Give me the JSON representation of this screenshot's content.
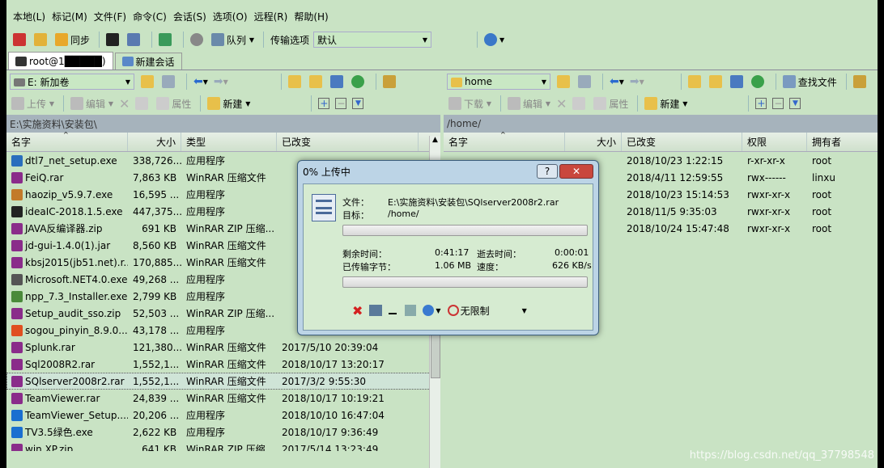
{
  "menu": [
    "本地(L)",
    "标记(M)",
    "文件(F)",
    "命令(C)",
    "会话(S)",
    "选项(O)",
    "远程(R)",
    "帮助(H)"
  ],
  "toolbar": {
    "sync_label": "同步",
    "queue_label": "队列",
    "transfer_options_label": "传输选项",
    "transfer_options_value": "默认"
  },
  "tabs": [
    {
      "label": "root@1█████)"
    },
    {
      "label": "新建会话"
    }
  ],
  "left": {
    "drive": "E: 新加卷",
    "upload": "上传",
    "edit": "编辑",
    "properties": "属性",
    "new": "新建",
    "path": "E:\\实施资料\\安装包\\",
    "columns": [
      "名字",
      "大小",
      "类型",
      "已改变"
    ],
    "rows": [
      {
        "name": "dtl7_net_setup.exe",
        "size": "338,726...",
        "type": "应用程序",
        "date": "",
        "color": "#2a6ebd"
      },
      {
        "name": "FeiQ.rar",
        "size": "7,863 KB",
        "type": "WinRAR 压缩文件",
        "date": "",
        "color": "#8a2c8a"
      },
      {
        "name": "haozip_v5.9.7.exe",
        "size": "16,595 ...",
        "type": "应用程序",
        "date": "",
        "color": "#c27a2a"
      },
      {
        "name": "ideaIC-2018.1.5.exe",
        "size": "447,375...",
        "type": "应用程序",
        "date": "",
        "color": "#222"
      },
      {
        "name": "JAVA反编译器.zip",
        "size": "691 KB",
        "type": "WinRAR ZIP 压缩...",
        "date": "",
        "color": "#8a2c8a"
      },
      {
        "name": "jd-gui-1.4.0(1).jar",
        "size": "8,560 KB",
        "type": "WinRAR 压缩文件",
        "date": "",
        "color": "#8a2c8a"
      },
      {
        "name": "kbsj2015(jb51.net).r...",
        "size": "170,885...",
        "type": "WinRAR 压缩文件",
        "date": "",
        "color": "#8a2c8a"
      },
      {
        "name": "Microsoft.NET4.0.exe",
        "size": "49,268 ...",
        "type": "应用程序",
        "date": "",
        "color": "#555"
      },
      {
        "name": "npp_7.3_Installer.exe",
        "size": "2,799 KB",
        "type": "应用程序",
        "date": "",
        "color": "#4a8a3a"
      },
      {
        "name": "Setup_audit_sso.zip",
        "size": "52,503 ...",
        "type": "WinRAR ZIP 压缩...",
        "date": "",
        "color": "#8a2c8a"
      },
      {
        "name": "sogou_pinyin_8.9.0....",
        "size": "43,178 ...",
        "type": "应用程序",
        "date": "",
        "color": "#e05020"
      },
      {
        "name": "Splunk.rar",
        "size": "121,380...",
        "type": "WinRAR 压缩文件",
        "date": "2017/5/10   20:39:04",
        "color": "#8a2c8a"
      },
      {
        "name": "Sql2008R2.rar",
        "size": "1,552,1...",
        "type": "WinRAR 压缩文件",
        "date": "2018/10/17  13:20:17",
        "color": "#8a2c8a"
      },
      {
        "name": "SQlserver2008r2.rar",
        "size": "1,552,1...",
        "type": "WinRAR 压缩文件",
        "date": "2017/3/2   9:55:30",
        "color": "#8a2c8a",
        "selected": true
      },
      {
        "name": "TeamViewer.rar",
        "size": "24,839 ...",
        "type": "WinRAR 压缩文件",
        "date": "2018/10/17  10:19:21",
        "color": "#8a2c8a"
      },
      {
        "name": "TeamViewer_Setup....",
        "size": "20,206 ...",
        "type": "应用程序",
        "date": "2018/10/10  16:47:04",
        "color": "#1a6fd0"
      },
      {
        "name": "TV3.5绿色.exe",
        "size": "2,622 KB",
        "type": "应用程序",
        "date": "2018/10/17  9:36:49",
        "color": "#1a6fd0"
      },
      {
        "name": "win XP.zip",
        "size": "641 KB",
        "type": "WinRAR ZIP 压缩...",
        "date": "2017/5/14  13:23:49",
        "color": "#8a2c8a"
      }
    ]
  },
  "right": {
    "dir": "home",
    "find_files": "查找文件",
    "download": "下载",
    "edit": "编辑",
    "properties": "属性",
    "new": "新建",
    "path": "/home/",
    "columns": [
      "名字",
      "大小",
      "已改变",
      "权限",
      "拥有者"
    ],
    "rows": [
      {
        "date": "2018/10/23 1:22:15",
        "perm": "r-xr-xr-x",
        "owner": "root"
      },
      {
        "date": "2018/4/11 12:59:55",
        "perm": "rwx------",
        "owner": "linxu"
      },
      {
        "date": "2018/10/23 15:14:53",
        "perm": "rwxr-xr-x",
        "owner": "root"
      },
      {
        "date": "2018/11/5 9:35:03",
        "perm": "rwxr-xr-x",
        "owner": "root"
      },
      {
        "date": "2018/10/24 15:47:48",
        "perm": "rwxr-xr-x",
        "owner": "root"
      }
    ]
  },
  "dialog": {
    "title": "0% 上传中",
    "help": "?",
    "close": "✕",
    "file_label": "文件：",
    "file_value": "E:\\实施资料\\安装包\\SQlserver2008r2.rar",
    "target_label": "目标：",
    "target_value": "/home/",
    "remaining_label": "剩余时间：",
    "remaining_value": "0:41:17",
    "elapsed_label": "逝去时间：",
    "elapsed_value": "0:00:01",
    "transferred_label": "已传输字节：",
    "transferred_value": "1.06 MB",
    "speed_label": "速度：",
    "speed_value": "626 KB/s",
    "progress_fraction": 0.0,
    "limit_label": "无限制"
  },
  "watermark": "https://blog.csdn.net/qq_37798548"
}
